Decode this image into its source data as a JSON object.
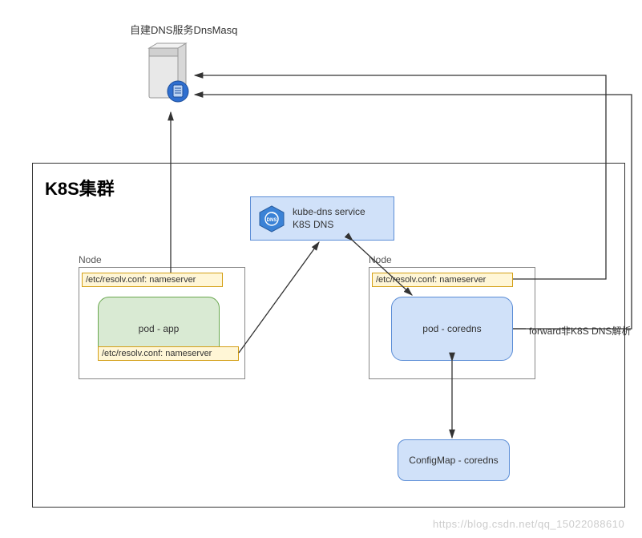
{
  "dns_server": {
    "label": "自建DNS服务DnsMasq"
  },
  "cluster": {
    "title": "K8S集群",
    "kube_dns": {
      "line1": "kube-dns service",
      "line2": "K8S DNS"
    }
  },
  "node_left": {
    "title": "Node",
    "resolv": "/etc/resolv.conf: nameserver",
    "pod": "pod - app",
    "pod_resolv": "/etc/resolv.conf: nameserver"
  },
  "node_right": {
    "title": "Node",
    "resolv": "/etc/resolv.conf: nameserver",
    "pod": "pod -  coredns"
  },
  "forward_label": "forward非K8S DNS解析",
  "configmap": {
    "label": "ConfigMap - coredns"
  },
  "watermark": "https://blog.csdn.net/qq_15022088610",
  "colors": {
    "green_fill": "#d9ead3",
    "green_stroke": "#6aa84f",
    "blue_fill": "#d0e1f9",
    "blue_stroke": "#5b8dd6",
    "yellow_fill": "#fff6d6",
    "yellow_stroke": "#d4a017"
  }
}
